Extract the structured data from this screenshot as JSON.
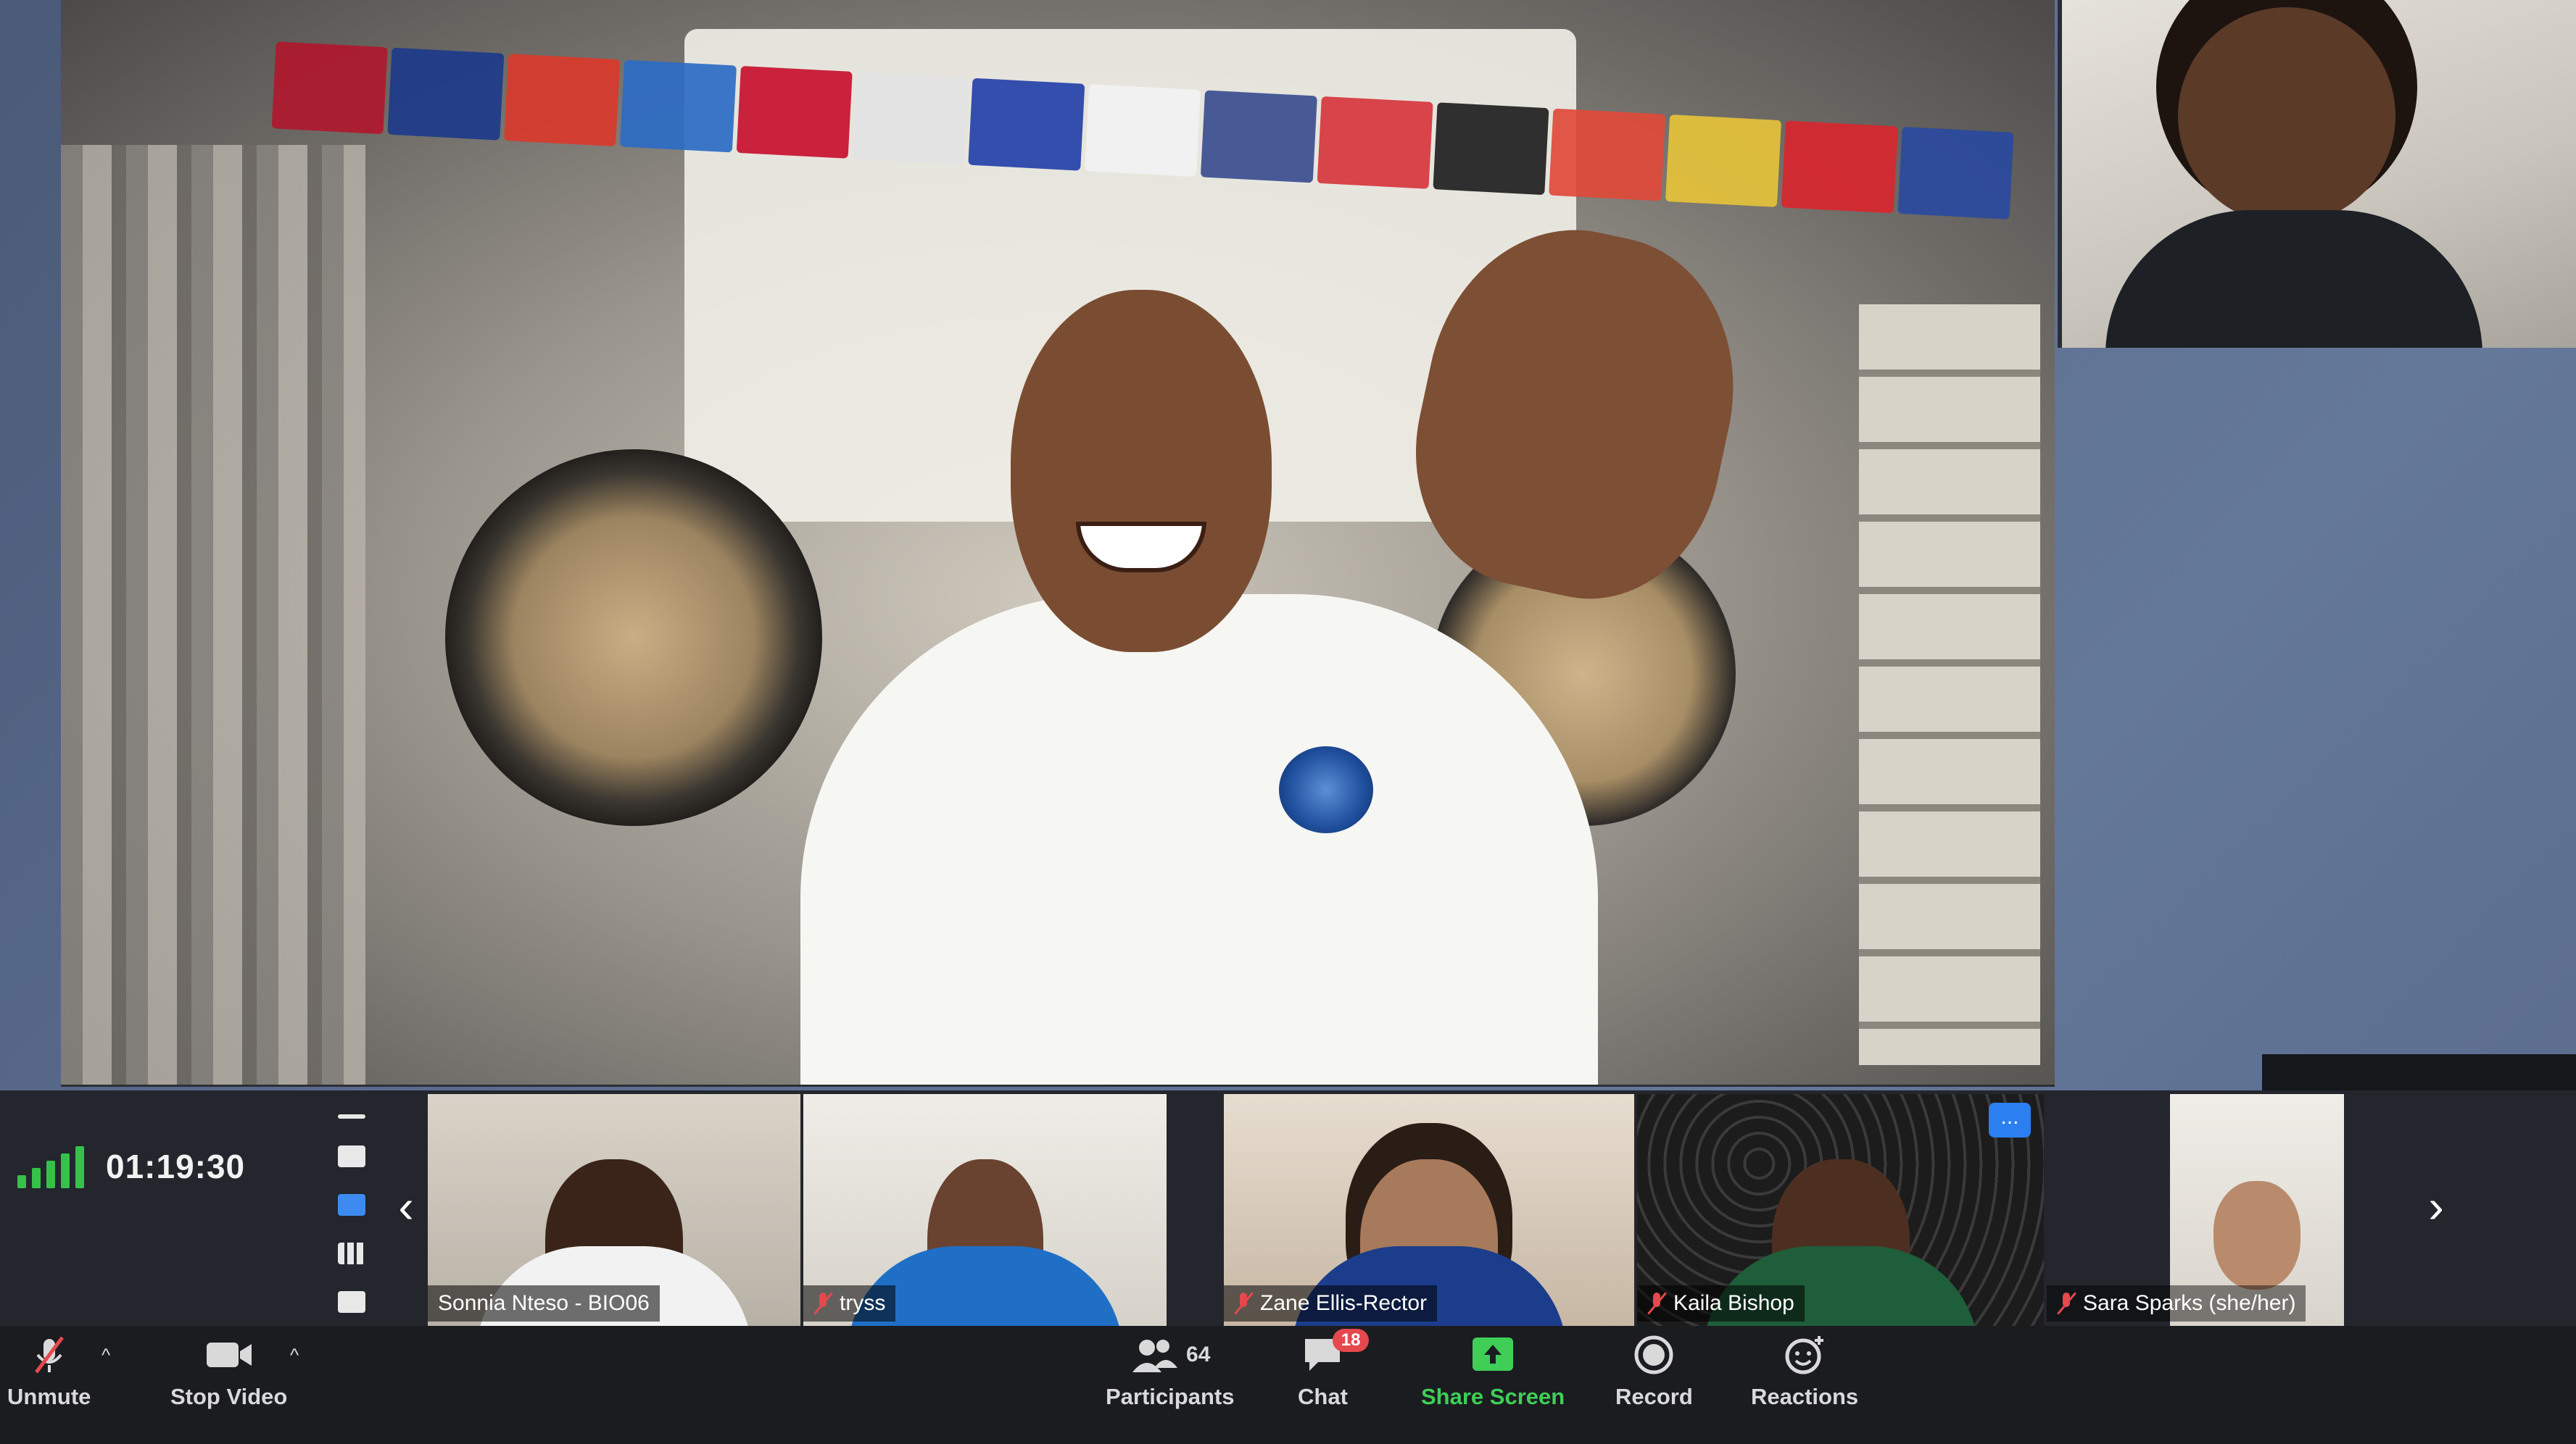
{
  "meeting": {
    "elapsed_time": "01:19:30"
  },
  "gallery": {
    "tiles": [
      {
        "name": "Sonnia Nteso - BIO06",
        "muted": false
      },
      {
        "name": "tryss",
        "muted": true
      },
      {
        "name": "Zane Ellis-Rector",
        "muted": true
      },
      {
        "name": "Kaila Bishop",
        "muted": true
      },
      {
        "name": "Sara Sparks (she/her)",
        "muted": true
      }
    ],
    "more_label": "..."
  },
  "toolbar": {
    "unmute_label": "Unmute",
    "stop_video_label": "Stop Video",
    "participants_label": "Participants",
    "participants_count": "64",
    "chat_label": "Chat",
    "chat_badge": "18",
    "share_screen_label": "Share Screen",
    "record_label": "Record",
    "reactions_label": "Reactions"
  },
  "nav": {
    "prev_icon": "‹",
    "next_icon": "›"
  },
  "colors": {
    "accent_blue": "#2b7ff0",
    "share_green": "#3fcf56",
    "muted_red": "#e5484d",
    "signal_green": "#36c24a"
  },
  "icons": [
    "signal-icon",
    "mic-off-icon",
    "video-camera-icon",
    "participants-icon",
    "chat-icon",
    "share-screen-icon",
    "record-icon",
    "reactions-icon",
    "gallery-view-icon"
  ]
}
